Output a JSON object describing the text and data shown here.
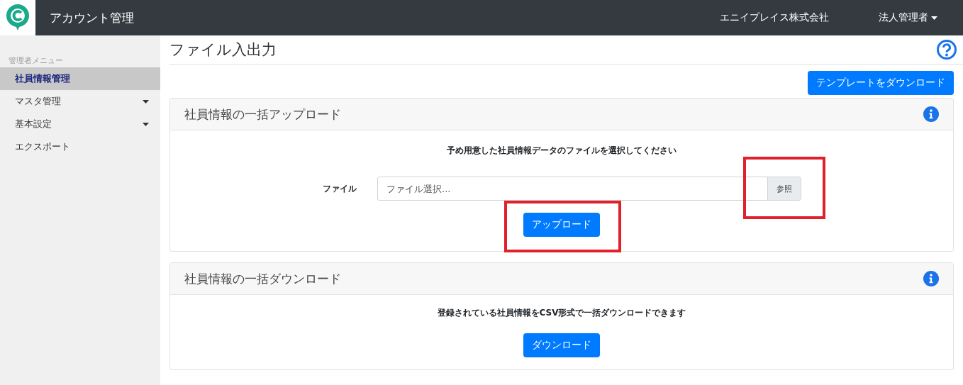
{
  "header": {
    "title": "アカウント管理",
    "company": "エニイプレイス株式会社",
    "user_menu": "法人管理者"
  },
  "sidebar": {
    "heading": "管理者メニュー",
    "items": [
      {
        "label": "社員情報管理",
        "selected": true,
        "has_submenu": false
      },
      {
        "label": "マスタ管理",
        "selected": false,
        "has_submenu": true
      },
      {
        "label": "基本設定",
        "selected": false,
        "has_submenu": true
      },
      {
        "label": "エクスポート",
        "selected": false,
        "has_submenu": false
      }
    ]
  },
  "page": {
    "title": "ファイル入出力",
    "template_button": "テンプレートをダウンロード"
  },
  "cards": [
    {
      "kind": "upload",
      "title": "社員情報の一括アップロード",
      "description": "予め用意した社員情報データのファイルを選択してください",
      "file_label": "ファイル",
      "placeholder": "ファイル選択...",
      "browse_button": "参照",
      "browse_highlighted": true,
      "button": "アップロード",
      "button_highlighted": true
    },
    {
      "kind": "download",
      "title": "社員情報の一括ダウンロード",
      "description": "登録されている社員情報をCSV形式で一括ダウンロードできます",
      "button": "ダウンロード",
      "button_highlighted": false
    }
  ]
}
